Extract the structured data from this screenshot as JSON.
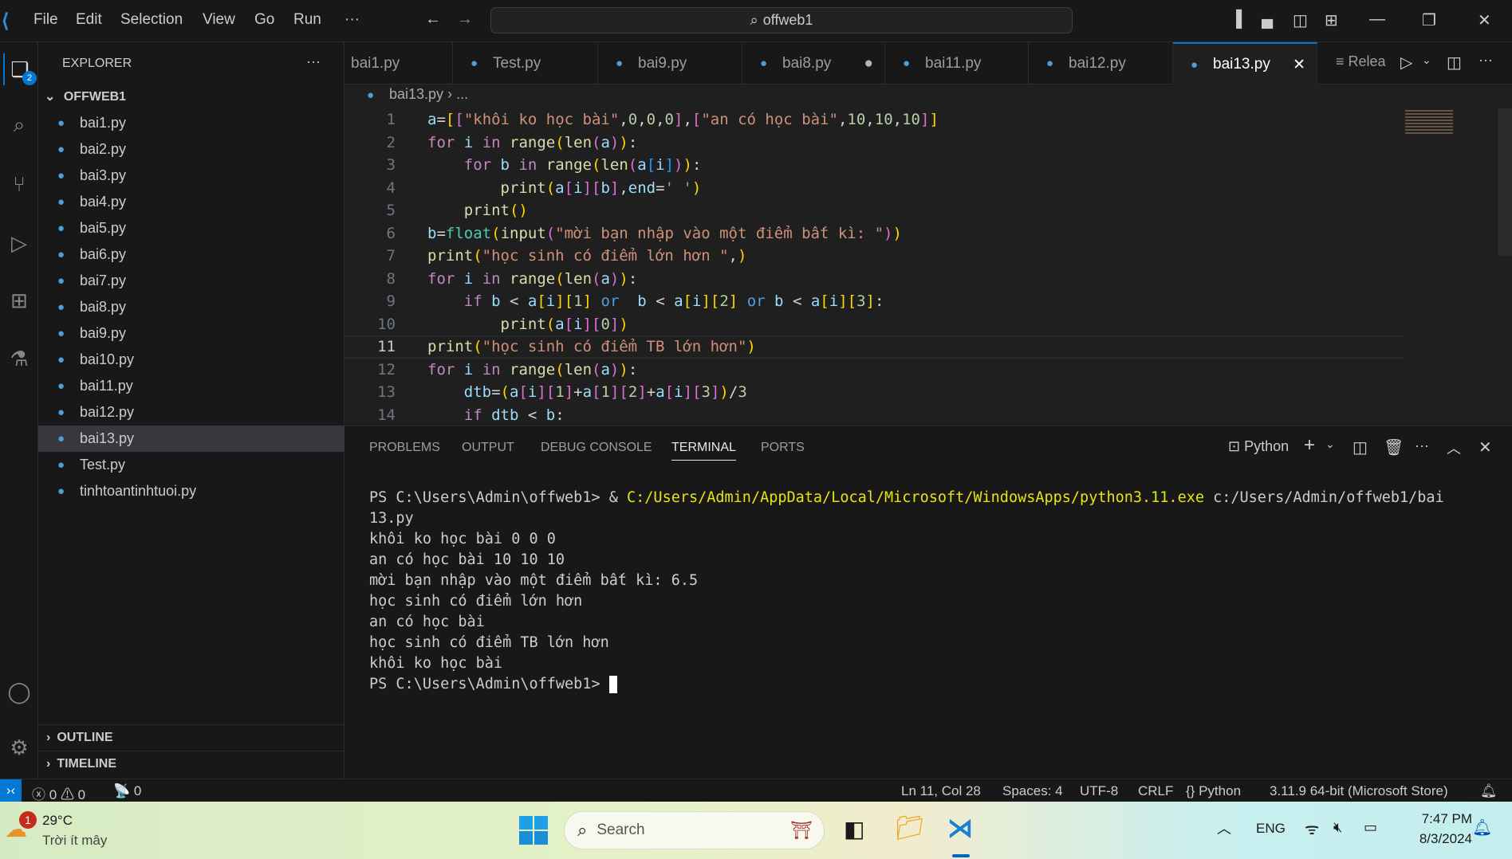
{
  "titlebar": {
    "menu": [
      "File",
      "Edit",
      "Selection",
      "View",
      "Go",
      "Run",
      "···"
    ],
    "search": "offweb1"
  },
  "activity": {
    "explorer_badge": "2"
  },
  "sidebar": {
    "title": "EXPLORER",
    "more": "···",
    "folder": "OFFWEB1",
    "files": [
      "bai1.py",
      "bai2.py",
      "bai3.py",
      "bai4.py",
      "bai5.py",
      "bai6.py",
      "bai7.py",
      "bai8.py",
      "bai9.py",
      "bai10.py",
      "bai11.py",
      "bai12.py",
      "bai13.py",
      "Test.py",
      "tinhtoantinhtuoi.py"
    ],
    "selected": "bai13.py",
    "outline": "OUTLINE",
    "timeline": "TIMELINE"
  },
  "tabs": [
    {
      "label": "bai1.py"
    },
    {
      "label": "Test.py"
    },
    {
      "label": "bai9.py"
    },
    {
      "label": "bai8.py",
      "modified": true
    },
    {
      "label": "bai11.py"
    },
    {
      "label": "bai12.py"
    },
    {
      "label": "bai13.py",
      "active": true
    }
  ],
  "tab_actions": {
    "release": "Relea"
  },
  "breadcrumb": {
    "file": "bai13.py",
    "rest": "..."
  },
  "editor": {
    "current_line": 11,
    "lines": [
      [
        [
          "a",
          "v"
        ],
        [
          "=",
          "p"
        ],
        [
          "[",
          "b1"
        ],
        [
          "[",
          "b2"
        ],
        [
          "\"khôi ko học bài\"",
          "s"
        ],
        [
          ",",
          "p"
        ],
        [
          "0",
          "n"
        ],
        [
          ",",
          "p"
        ],
        [
          "0",
          "n"
        ],
        [
          ",",
          "p"
        ],
        [
          "0",
          "n"
        ],
        [
          "]",
          "b2"
        ],
        [
          ",",
          "p"
        ],
        [
          "[",
          "b2"
        ],
        [
          "\"an có học bài\"",
          "s"
        ],
        [
          ",",
          "p"
        ],
        [
          "10",
          "n"
        ],
        [
          ",",
          "p"
        ],
        [
          "10",
          "n"
        ],
        [
          ",",
          "p"
        ],
        [
          "10",
          "n"
        ],
        [
          "]",
          "b2"
        ],
        [
          "]",
          "b1"
        ]
      ],
      [
        [
          "for",
          "kw"
        ],
        [
          " ",
          "p"
        ],
        [
          "i",
          "v"
        ],
        [
          " ",
          "p"
        ],
        [
          "in",
          "kw"
        ],
        [
          " ",
          "p"
        ],
        [
          "range",
          "fn"
        ],
        [
          "(",
          "b1"
        ],
        [
          "len",
          "fn"
        ],
        [
          "(",
          "b2"
        ],
        [
          "a",
          "v"
        ],
        [
          ")",
          "b2"
        ],
        [
          ")",
          "b1"
        ],
        [
          ":",
          "p"
        ]
      ],
      [
        [
          "    ",
          "p"
        ],
        [
          "for",
          "kw"
        ],
        [
          " ",
          "p"
        ],
        [
          "b",
          "v"
        ],
        [
          " ",
          "p"
        ],
        [
          "in",
          "kw"
        ],
        [
          " ",
          "p"
        ],
        [
          "range",
          "fn"
        ],
        [
          "(",
          "b1"
        ],
        [
          "len",
          "fn"
        ],
        [
          "(",
          "b2"
        ],
        [
          "a",
          "v"
        ],
        [
          "[",
          "b3"
        ],
        [
          "i",
          "v"
        ],
        [
          "]",
          "b3"
        ],
        [
          ")",
          "b2"
        ],
        [
          ")",
          "b1"
        ],
        [
          ":",
          "p"
        ]
      ],
      [
        [
          "        ",
          "p"
        ],
        [
          "print",
          "fn"
        ],
        [
          "(",
          "b1"
        ],
        [
          "a",
          "v"
        ],
        [
          "[",
          "b2"
        ],
        [
          "i",
          "v"
        ],
        [
          "]",
          "b2"
        ],
        [
          "[",
          "b2"
        ],
        [
          "b",
          "v"
        ],
        [
          "]",
          "b2"
        ],
        [
          ",",
          "p"
        ],
        [
          "end",
          "v"
        ],
        [
          "=",
          "p"
        ],
        [
          "' '",
          "s"
        ],
        [
          ")",
          "b1"
        ]
      ],
      [
        [
          "    ",
          "p"
        ],
        [
          "print",
          "fn"
        ],
        [
          "()",
          "b1"
        ]
      ],
      [
        [
          "b",
          "v"
        ],
        [
          "=",
          "p"
        ],
        [
          "float",
          "cls"
        ],
        [
          "(",
          "b1"
        ],
        [
          "input",
          "fn"
        ],
        [
          "(",
          "b2"
        ],
        [
          "\"mời bạn nhập vào một điểm bất kì: \"",
          "s"
        ],
        [
          ")",
          "b2"
        ],
        [
          ")",
          "b1"
        ]
      ],
      [
        [
          "print",
          "fn"
        ],
        [
          "(",
          "b1"
        ],
        [
          "\"học sinh có điểm lớn hơn \"",
          "s"
        ],
        [
          ",",
          "p"
        ],
        [
          ")",
          "b1"
        ]
      ],
      [
        [
          "for",
          "kw"
        ],
        [
          " ",
          "p"
        ],
        [
          "i",
          "v"
        ],
        [
          " ",
          "p"
        ],
        [
          "in",
          "kw"
        ],
        [
          " ",
          "p"
        ],
        [
          "range",
          "fn"
        ],
        [
          "(",
          "b1"
        ],
        [
          "len",
          "fn"
        ],
        [
          "(",
          "b2"
        ],
        [
          "a",
          "v"
        ],
        [
          ")",
          "b2"
        ],
        [
          ")",
          "b1"
        ],
        [
          ":",
          "p"
        ]
      ],
      [
        [
          "    ",
          "p"
        ],
        [
          "if",
          "kw"
        ],
        [
          " ",
          "p"
        ],
        [
          "b",
          "v"
        ],
        [
          " < ",
          "p"
        ],
        [
          "a",
          "v"
        ],
        [
          "[",
          "b1"
        ],
        [
          "i",
          "v"
        ],
        [
          "]",
          "b1"
        ],
        [
          "[",
          "b1"
        ],
        [
          "1",
          "n"
        ],
        [
          "]",
          "b1"
        ],
        [
          " ",
          "p"
        ],
        [
          "or",
          "op"
        ],
        [
          "  ",
          "p"
        ],
        [
          "b",
          "v"
        ],
        [
          " < ",
          "p"
        ],
        [
          "a",
          "v"
        ],
        [
          "[",
          "b1"
        ],
        [
          "i",
          "v"
        ],
        [
          "]",
          "b1"
        ],
        [
          "[",
          "b1"
        ],
        [
          "2",
          "n"
        ],
        [
          "]",
          "b1"
        ],
        [
          " ",
          "p"
        ],
        [
          "or",
          "op"
        ],
        [
          " ",
          "p"
        ],
        [
          "b",
          "v"
        ],
        [
          " < ",
          "p"
        ],
        [
          "a",
          "v"
        ],
        [
          "[",
          "b1"
        ],
        [
          "i",
          "v"
        ],
        [
          "]",
          "b1"
        ],
        [
          "[",
          "b1"
        ],
        [
          "3",
          "n"
        ],
        [
          "]",
          "b1"
        ],
        [
          ":",
          "p"
        ]
      ],
      [
        [
          "        ",
          "p"
        ],
        [
          "print",
          "fn"
        ],
        [
          "(",
          "b1"
        ],
        [
          "a",
          "v"
        ],
        [
          "[",
          "b2"
        ],
        [
          "i",
          "v"
        ],
        [
          "]",
          "b2"
        ],
        [
          "[",
          "b2"
        ],
        [
          "0",
          "n"
        ],
        [
          "]",
          "b2"
        ],
        [
          ")",
          "b1"
        ]
      ],
      [
        [
          "print",
          "fn"
        ],
        [
          "(",
          "b1"
        ],
        [
          "\"học sinh có điểm TB lớn hơn\"",
          "s"
        ],
        [
          ")",
          "b1"
        ]
      ],
      [
        [
          "for",
          "kw"
        ],
        [
          " ",
          "p"
        ],
        [
          "i",
          "v"
        ],
        [
          " ",
          "p"
        ],
        [
          "in",
          "kw"
        ],
        [
          " ",
          "p"
        ],
        [
          "range",
          "fn"
        ],
        [
          "(",
          "b1"
        ],
        [
          "len",
          "fn"
        ],
        [
          "(",
          "b2"
        ],
        [
          "a",
          "v"
        ],
        [
          ")",
          "b2"
        ],
        [
          ")",
          "b1"
        ],
        [
          ":",
          "p"
        ]
      ],
      [
        [
          "    ",
          "p"
        ],
        [
          "dtb",
          "v"
        ],
        [
          "=",
          "p"
        ],
        [
          "(",
          "b1"
        ],
        [
          "a",
          "v"
        ],
        [
          "[",
          "b2"
        ],
        [
          "i",
          "v"
        ],
        [
          "]",
          "b2"
        ],
        [
          "[",
          "b2"
        ],
        [
          "1",
          "n"
        ],
        [
          "]",
          "b2"
        ],
        [
          "+",
          "p"
        ],
        [
          "a",
          "v"
        ],
        [
          "[",
          "b2"
        ],
        [
          "1",
          "n"
        ],
        [
          "]",
          "b2"
        ],
        [
          "[",
          "b2"
        ],
        [
          "2",
          "n"
        ],
        [
          "]",
          "b2"
        ],
        [
          "+",
          "p"
        ],
        [
          "a",
          "v"
        ],
        [
          "[",
          "b2"
        ],
        [
          "i",
          "v"
        ],
        [
          "]",
          "b2"
        ],
        [
          "[",
          "b2"
        ],
        [
          "3",
          "n"
        ],
        [
          "]",
          "b2"
        ],
        [
          ")",
          "b1"
        ],
        [
          "/",
          "p"
        ],
        [
          "3",
          "n"
        ]
      ],
      [
        [
          "    ",
          "p"
        ],
        [
          "if",
          "kw"
        ],
        [
          " ",
          "p"
        ],
        [
          "dtb",
          "v"
        ],
        [
          " < ",
          "p"
        ],
        [
          "b",
          "v"
        ],
        [
          ":",
          "p"
        ]
      ]
    ]
  },
  "panel": {
    "tabs": [
      "PROBLEMS",
      "OUTPUT",
      "DEBUG CONSOLE",
      "TERMINAL",
      "PORTS"
    ],
    "active": "TERMINAL",
    "shell": "Python"
  },
  "terminal": {
    "cmd": {
      "prompt": "PS C:\\Users\\Admin\\offweb1> & ",
      "exe": "C:/Users/Admin/AppData/Local/Microsoft/WindowsApps/python3.11.exe",
      "arg": " c:/Users/Admin/offweb1/bai",
      "wrap": "13.py"
    },
    "output": [
      "khôi ko học bài 0 0 0",
      "an có học bài 10 10 10",
      "mời bạn nhập vào một điểm bất kì: 6.5",
      "học sinh có điểm lớn hơn",
      "an có học bài",
      "học sinh có điểm TB lớn hơn",
      "khôi ko học bài"
    ],
    "prompt": "PS C:\\Users\\Admin\\offweb1> "
  },
  "status": {
    "errors": "0",
    "warnings": "0",
    "ports": "0",
    "position": "Ln 11, Col 28",
    "spaces": "Spaces: 4",
    "encoding": "UTF-8",
    "eol": "CRLF",
    "language": "Python",
    "interpreter": "3.11.9 64-bit (Microsoft Store)"
  },
  "taskbar": {
    "weather_temp": "29°C",
    "weather_desc": "Trời ít mây",
    "weather_badge": "1",
    "search": "Search",
    "lang": "ENG",
    "time": "7:47 PM",
    "date": "8/3/2024"
  }
}
